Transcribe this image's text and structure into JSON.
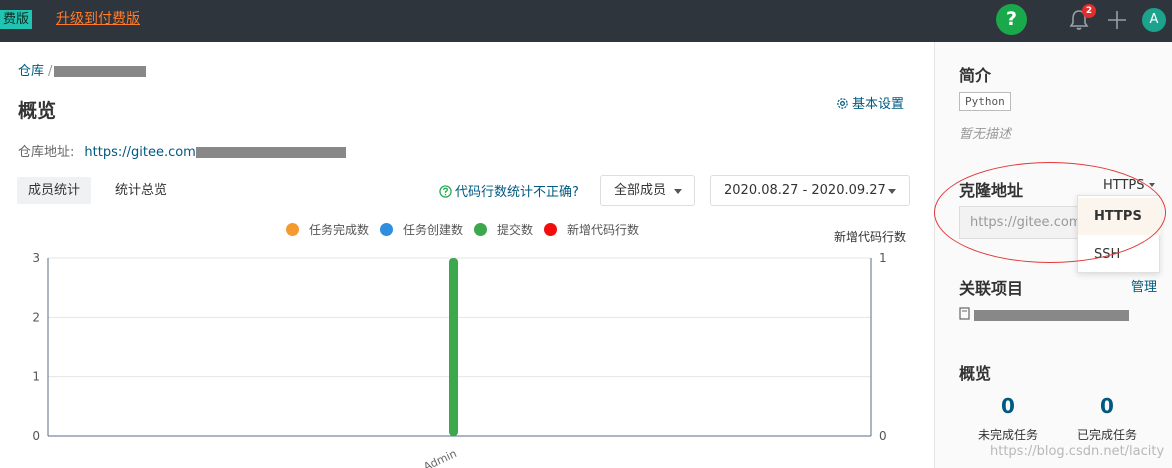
{
  "topbar": {
    "free_badge": "费版",
    "upgrade_label": "升级到付费版",
    "help_label": "?",
    "notification_count": "2",
    "avatar_letter": "A"
  },
  "breadcrumb": {
    "root": "仓库",
    "separator": "/"
  },
  "page": {
    "title": "概览",
    "settings_label": "基本设置",
    "repo_address_label": "仓库地址:",
    "repo_url_visible": "https://gitee.com"
  },
  "tabs": [
    {
      "label": "成员统计",
      "active": true
    },
    {
      "label": "统计总览",
      "active": false
    }
  ],
  "filters": {
    "stat_hint": "代码行数统计不正确?",
    "member_select": "全部成员",
    "date_range": "2020.08.27 - 2020.09.27"
  },
  "colors": {
    "accent": "#005980",
    "upgrade": "#ff7a29",
    "help_green": "#1aa94a",
    "bar_green": "#3ba84c"
  },
  "chart_data": {
    "type": "bar",
    "categories": [
      "Admin"
    ],
    "series": [
      {
        "name": "任务完成数",
        "color": "#f59a2e",
        "values": [
          0
        ]
      },
      {
        "name": "任务创建数",
        "color": "#2f8ee0",
        "values": [
          0
        ]
      },
      {
        "name": "提交数",
        "color": "#3ba84c",
        "values": [
          3
        ]
      },
      {
        "name": "新增代码行数",
        "color": "#f20d0d",
        "values": [
          0
        ]
      }
    ],
    "y_left": {
      "ticks": [
        "3",
        "2",
        "1",
        "0"
      ],
      "range": [
        0,
        3
      ]
    },
    "y_right": {
      "title": "新增代码行数",
      "ticks": [
        "1",
        "0"
      ],
      "range": [
        0,
        1
      ]
    },
    "legend_position": "top",
    "grid": true
  },
  "sidebar": {
    "intro_title": "简介",
    "language_tag": "Python",
    "description": "暂无描述",
    "clone_title": "克隆地址",
    "protocol": "HTTPS",
    "clone_input": "https://gitee.com",
    "dropdown": [
      "HTTPS",
      "SSH"
    ],
    "linked_title": "关联项目",
    "manage_label": "管理",
    "overview_title": "概览",
    "stats": [
      {
        "value": "0",
        "label": "未完成任务"
      },
      {
        "value": "0",
        "label": "已完成任务"
      }
    ],
    "watermark": "https://blog.csdn.net/lacity"
  }
}
